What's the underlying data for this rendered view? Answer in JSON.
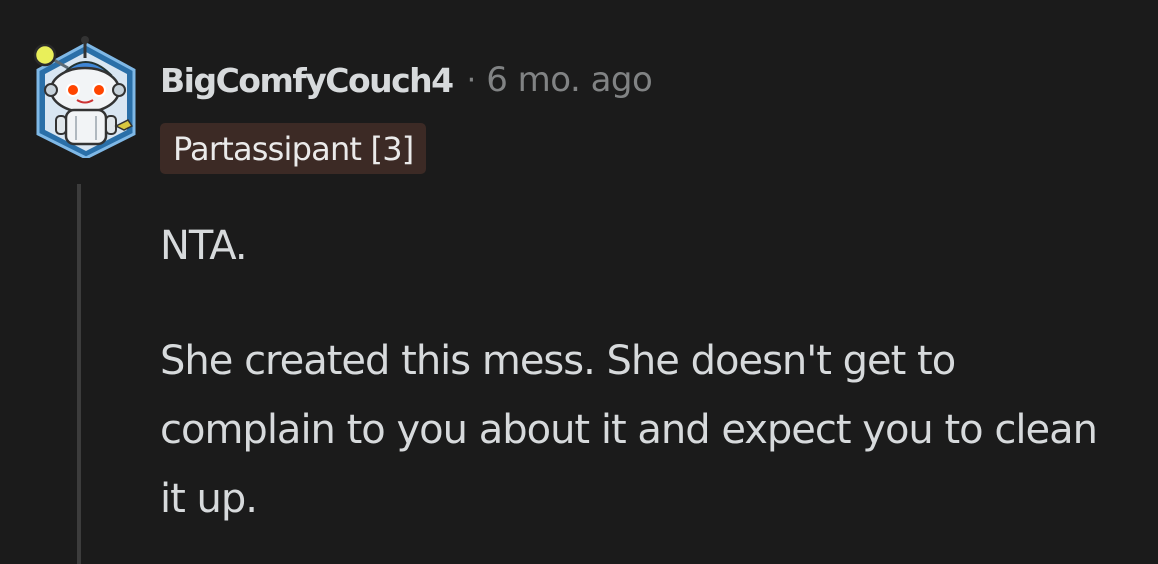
{
  "comment": {
    "author": "BigComfyCouch4",
    "separator": "·",
    "timestamp": "6 mo. ago",
    "flair": "Partassipant [3]",
    "paragraphs": [
      "NTA.",
      "She created this mess. She doesn't get to complain to you about it and expect you to clean it up."
    ],
    "avatar_icon": "snoo-robot-avatar-icon"
  },
  "colors": {
    "background": "#1b1b1b",
    "text_primary": "#d7dadc",
    "text_muted": "#818384",
    "flair_bg": "#3c2a25",
    "thread_line": "#3c3c3c"
  }
}
